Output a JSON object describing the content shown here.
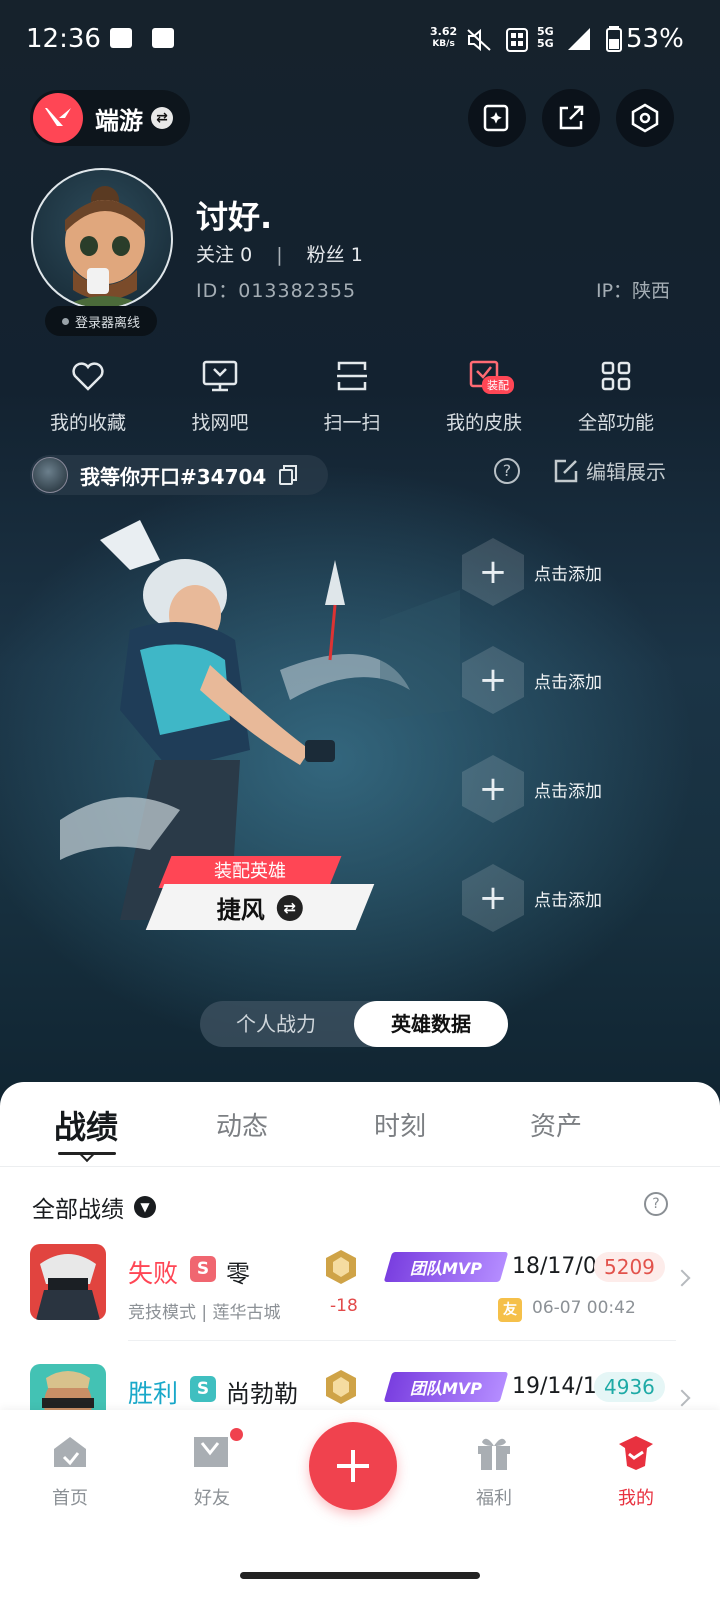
{
  "status_bar": {
    "time": "12:36",
    "net_speed_value": "3.62",
    "net_speed_unit": "KB/s",
    "signal_1": "5G",
    "signal_2": "5G",
    "battery": "53%"
  },
  "header": {
    "game_name": "端游",
    "icons": [
      "edit-card-icon",
      "share-icon",
      "settings-icon"
    ]
  },
  "profile": {
    "nickname": "讨好.",
    "follow_label": "关注",
    "follow_count": "0",
    "fans_label": "粉丝",
    "fans_count": "1",
    "id_text": "ID：013382355",
    "ip_text": "IP：陕西",
    "online_status": "登录器离线"
  },
  "quick_menu": [
    {
      "label": "我的收藏",
      "icon": "heart-icon"
    },
    {
      "label": "找网吧",
      "icon": "monitor-icon"
    },
    {
      "label": "扫一扫",
      "icon": "scan-icon"
    },
    {
      "label": "我的皮肤",
      "icon": "skin-icon",
      "badge": "装配"
    },
    {
      "label": "全部功能",
      "icon": "grid-icon"
    }
  ],
  "role": {
    "name": "我等你开口#34704",
    "edit_label": "编辑展示"
  },
  "showcase": {
    "equip_label": "装配英雄",
    "hero_name": "捷风",
    "slots": [
      "点击添加",
      "点击添加",
      "点击添加",
      "点击添加"
    ]
  },
  "segment": {
    "options": [
      "个人战力",
      "英雄数据"
    ],
    "selected": "英雄数据"
  },
  "tabs": [
    "战绩",
    "动态",
    "时刻",
    "资产"
  ],
  "active_tab": "战绩",
  "records": {
    "filter_label": "全部战绩",
    "matches": [
      {
        "result": "失败",
        "badge": "S",
        "agent": "零",
        "mode": "竞技模式 | 莲华古城",
        "rr": "-18",
        "mvp": "团队MVP",
        "kda": "18/17/0",
        "score": "5209",
        "friend_badge": "友",
        "time": "06-07 00:42"
      },
      {
        "result": "胜利",
        "badge": "S",
        "agent": "尚勃勒",
        "mvp": "团队MVP",
        "kda": "19/14/1",
        "score": "4936"
      }
    ]
  },
  "bottom_nav": [
    {
      "label": "首页",
      "icon": "home-icon"
    },
    {
      "label": "好友",
      "icon": "friends-icon"
    },
    {
      "label": "",
      "icon": "plus-icon"
    },
    {
      "label": "福利",
      "icon": "gift-icon"
    },
    {
      "label": "我的",
      "icon": "profile-icon"
    }
  ],
  "colors": {
    "accent": "#ff4655",
    "lose": "#ff4655",
    "win": "#19a8c9",
    "mvp": "#7a3fe0"
  }
}
